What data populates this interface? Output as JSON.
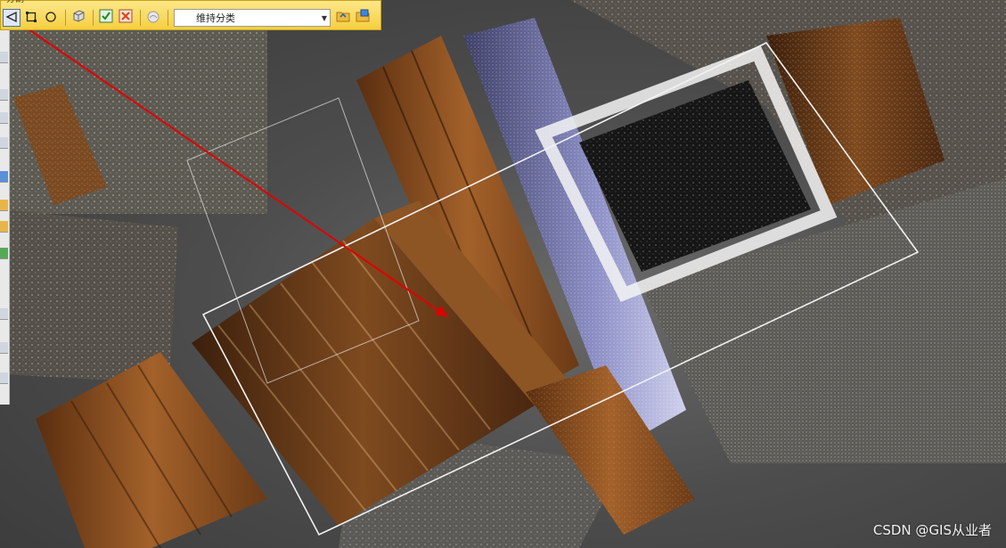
{
  "toolbar": {
    "title": "分割",
    "mode_select": {
      "selected": "维持分类"
    },
    "tools": [
      {
        "name": "polygon-select-tool-icon",
        "active": true
      },
      {
        "name": "rectangle-select-tool-icon",
        "active": false
      },
      {
        "name": "circle-select-tool-icon",
        "active": false
      },
      {
        "name": "cube-view-tool-icon",
        "active": false
      },
      {
        "name": "confirm-selection-icon",
        "active": false
      },
      {
        "name": "cancel-selection-icon",
        "active": false
      },
      {
        "name": "cloud-tool-icon",
        "active": false
      },
      {
        "name": "open-folder-icon",
        "active": false
      },
      {
        "name": "export-folder-icon",
        "active": false
      }
    ]
  },
  "watermark": "CSDN @GIS从业者",
  "colors": {
    "toolbar_bg": "#f6cf3f",
    "annotation_arrow": "#e00000",
    "selection_box": "#ffffff",
    "wood": "#9a5a22",
    "wall_blue": "#7b7fb8"
  }
}
